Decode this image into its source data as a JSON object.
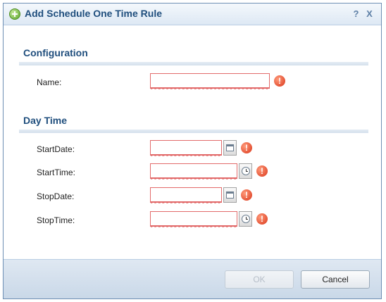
{
  "dialog": {
    "title": "Add Schedule One Time Rule",
    "help_label": "?",
    "close_label": "X"
  },
  "sections": {
    "configuration": "Configuration",
    "day_time": "Day Time"
  },
  "fields": {
    "name": {
      "label": "Name:",
      "value": ""
    },
    "start_date": {
      "label": "StartDate:",
      "value": ""
    },
    "start_time": {
      "label": "StartTime:",
      "value": ""
    },
    "stop_date": {
      "label": "StopDate:",
      "value": ""
    },
    "stop_time": {
      "label": "StopTime:",
      "value": ""
    }
  },
  "error_glyph": "!",
  "buttons": {
    "ok": "OK",
    "cancel": "Cancel"
  }
}
